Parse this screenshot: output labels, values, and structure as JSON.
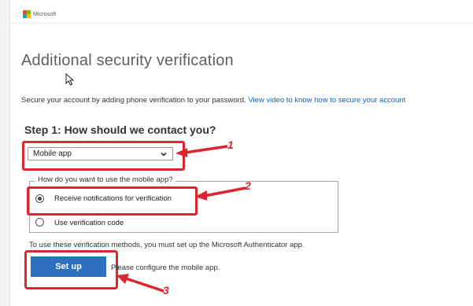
{
  "brand": {
    "name": "Microsoft"
  },
  "page": {
    "title": "Additional security verification",
    "intro_text": "Secure your account by adding phone verification to your password.",
    "intro_link": "View video to know how to secure your account"
  },
  "step1": {
    "heading": "Step 1: How should we contact you?",
    "contact_method_selected": "Mobile app"
  },
  "mobile_app": {
    "legend": "How do you want to use the mobile app?",
    "options": [
      {
        "label": "Receive notifications for verification",
        "checked": true
      },
      {
        "label": "Use verification code",
        "checked": false
      }
    ]
  },
  "methods_note": "To use these verification methods, you must set up the Microsoft Authenticator app.",
  "setup": {
    "button_label": "Set up",
    "status_text": "Please configure the mobile app."
  },
  "annotations": {
    "markers": [
      "1",
      "2",
      "3"
    ],
    "color": "#d9262f"
  },
  "colors": {
    "logo": [
      "#f25022",
      "#7fba00",
      "#00a4ef",
      "#ffb900"
    ],
    "link": "#0d62ba",
    "button": "#2f6fbf"
  }
}
